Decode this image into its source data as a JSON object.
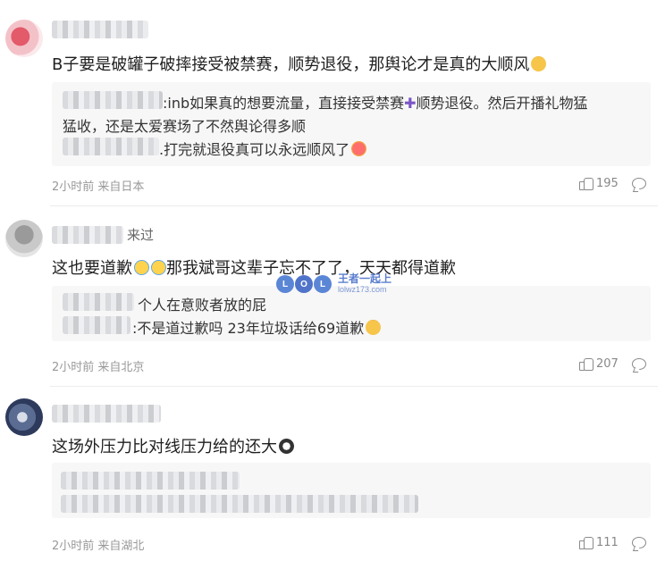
{
  "comments": [
    {
      "username": "B子",
      "text": "B子要是破罐子破摔接受被禁赛，顺势退役，那舆论才是真的大顺风",
      "replies": [
        {
          "name": "龙虾",
          "text": ":inb如果真的想要流量，直接接受禁赛",
          "text2": "顺势退役。然后开播礼物猛",
          "cont": "猛收，还是太爱赛场了不然舆论得多顺"
        },
        {
          "name": "是",
          "text": ".打完就退役真可以永远顺风了"
        }
      ],
      "time": "2小时前 来自日本",
      "likes": "195"
    },
    {
      "username": "来过",
      "text": "这也要道歉",
      "text_tail": "那我斌哥这辈子忘不了了，天天都得道歉",
      "replies": [
        {
          "name": "绘",
          "text": "个人在意败者放的屁"
        },
        {
          "name": "XX",
          "text": ":不是道过歉吗 23年垃圾话给69道歉"
        }
      ],
      "time": "2小时前 来自北京",
      "likes": "207"
    },
    {
      "username": "",
      "text": "这场外压力比对线压力给的还大",
      "replies": [],
      "time": "2小时前 来自湖北",
      "likes": "111"
    }
  ],
  "watermark": {
    "letters": [
      "L",
      "O",
      "L"
    ],
    "brand": "王者一起上",
    "url": "lolwz173.com"
  }
}
